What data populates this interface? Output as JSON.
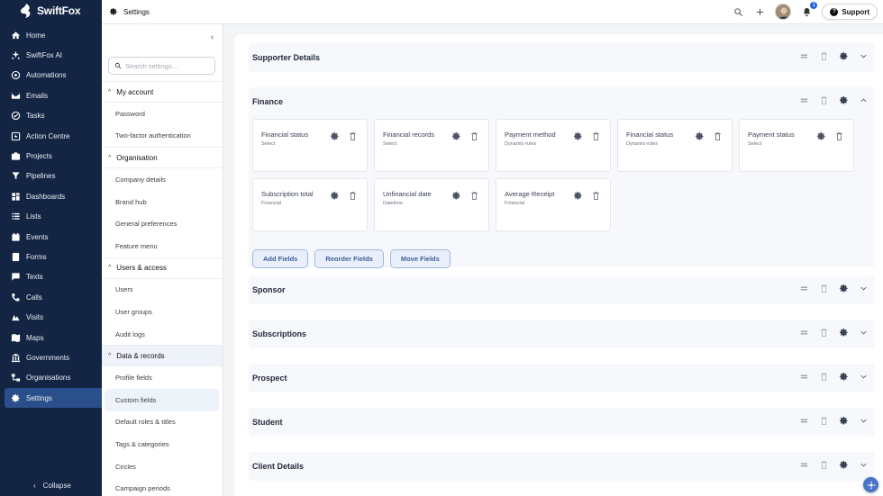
{
  "app": {
    "name": "SwiftFox"
  },
  "nav": {
    "items": [
      {
        "label": "Home",
        "icon": "home-icon"
      },
      {
        "label": "SwiftFox AI",
        "icon": "sparkle-icon"
      },
      {
        "label": "Automations",
        "icon": "automation-icon"
      },
      {
        "label": "Emails",
        "icon": "mail-icon"
      },
      {
        "label": "Tasks",
        "icon": "check-circle-icon"
      },
      {
        "label": "Action Centre",
        "icon": "bolt-icon"
      },
      {
        "label": "Projects",
        "icon": "projects-icon"
      },
      {
        "label": "Pipelines",
        "icon": "funnel-icon"
      },
      {
        "label": "Dashboards",
        "icon": "dashboard-icon"
      },
      {
        "label": "Lists",
        "icon": "list-icon"
      },
      {
        "label": "Events",
        "icon": "calendar-icon"
      },
      {
        "label": "Forms",
        "icon": "form-icon"
      },
      {
        "label": "Texts",
        "icon": "chat-icon"
      },
      {
        "label": "Calls",
        "icon": "phone-icon"
      },
      {
        "label": "Visits",
        "icon": "map-pin-icon"
      },
      {
        "label": "Maps",
        "icon": "map-icon"
      },
      {
        "label": "Governments",
        "icon": "building-icon"
      },
      {
        "label": "Organisations",
        "icon": "org-icon"
      },
      {
        "label": "Settings",
        "icon": "gear-icon",
        "active": true
      }
    ],
    "collapse_label": "Collapse"
  },
  "topbar": {
    "title": "Settings",
    "support_label": "Support",
    "notification_count": "1"
  },
  "settings_nav": {
    "search_placeholder": "Search settings...",
    "sections": [
      {
        "title": "My account",
        "items": [
          "Password",
          "Two-factor authentication"
        ]
      },
      {
        "title": "Organisation",
        "items": [
          "Company details",
          "Brand hub",
          "General preferences",
          "Feature menu"
        ]
      },
      {
        "title": "Users & access",
        "items": [
          "Users",
          "User groups",
          "Audit logs"
        ]
      },
      {
        "title": "Data & records",
        "items": [
          "Profile fields",
          "Custom fields",
          "Default roles & titles",
          "Tags & categories",
          "Circles",
          "Campaign periods"
        ]
      }
    ],
    "active_item": "Custom fields"
  },
  "groups": [
    {
      "title": "Supporter Details",
      "expanded": false
    },
    {
      "title": "Finance",
      "expanded": true,
      "fields": [
        {
          "label": "Financial status",
          "type": "Select"
        },
        {
          "label": "Financial records",
          "type": "Select"
        },
        {
          "label": "Payment method",
          "type": "Dynamic-rules"
        },
        {
          "label": "Financial status",
          "type": "Dynamic-rules"
        },
        {
          "label": "Payment status",
          "type": "Select"
        },
        {
          "label": "Subscription total",
          "type": "Financial"
        },
        {
          "label": "Unfinancial date",
          "type": "Datetime"
        },
        {
          "label": "Average Receipt",
          "type": "Financial"
        }
      ],
      "buttons": {
        "add": "Add Fields",
        "reorder": "Reorder Fields",
        "move": "Move Fields"
      }
    },
    {
      "title": "Sponsor",
      "expanded": false
    },
    {
      "title": "Subscriptions",
      "expanded": false
    },
    {
      "title": "Prospect",
      "expanded": false
    },
    {
      "title": "Student",
      "expanded": false
    },
    {
      "title": "Client Details",
      "expanded": false
    }
  ]
}
